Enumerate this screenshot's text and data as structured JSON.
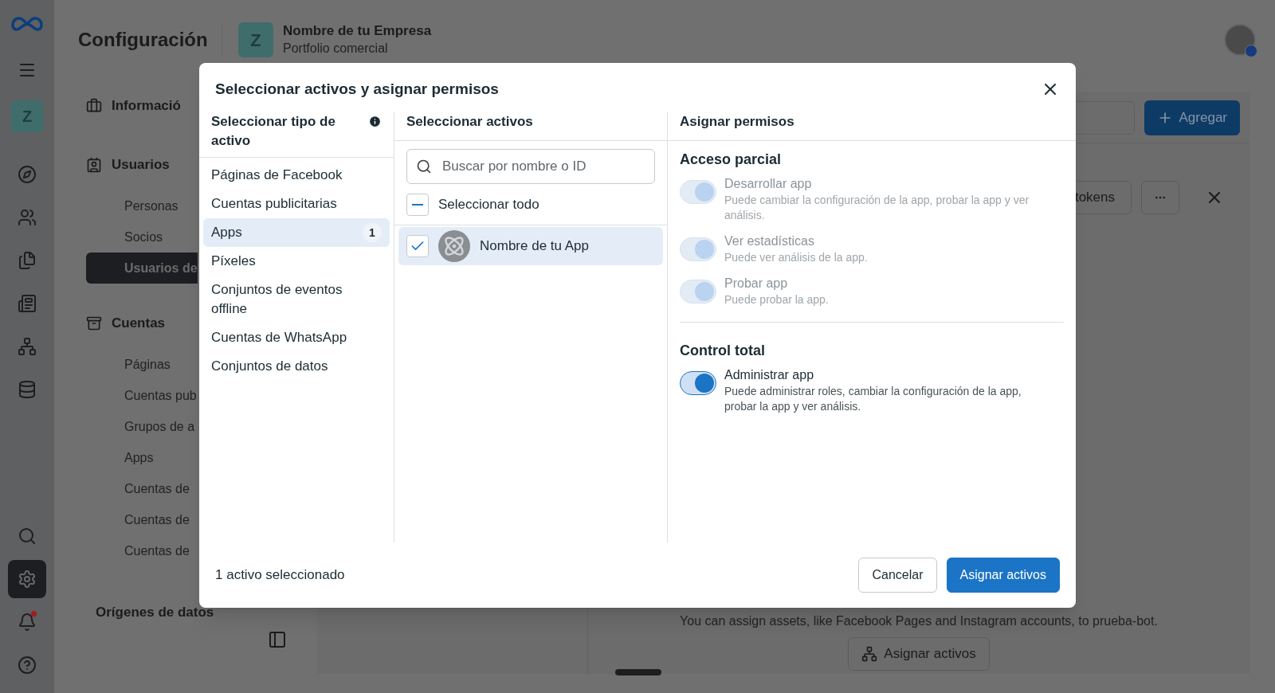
{
  "rail": {
    "avatar": "Z",
    "bottom_items": [
      {
        "selected": false,
        "notification": false
      },
      {
        "selected": true,
        "notification": false
      },
      {
        "selected": false,
        "notification": true
      },
      {
        "selected": false,
        "notification": false
      }
    ]
  },
  "header": {
    "title": "Configuración",
    "business": {
      "initial": "Z",
      "name": "Nombre de tu Empresa",
      "subtitle": "Portfolio comercial"
    }
  },
  "nav": {
    "sections": [
      {
        "title": "Informació"
      },
      {
        "title": "Usuarios",
        "items": [
          {
            "label": "Personas",
            "selected": false
          },
          {
            "label": "Socios",
            "selected": false
          },
          {
            "label": "Usuarios de",
            "selected": true
          }
        ]
      },
      {
        "title": "Cuentas",
        "items": [
          {
            "label": "Páginas",
            "selected": false
          },
          {
            "label": "Cuentas pub",
            "selected": false
          },
          {
            "label": "Grupos de a",
            "selected": false
          },
          {
            "label": "Apps",
            "selected": false
          },
          {
            "label": "Cuentas de",
            "selected": false
          },
          {
            "label": "Cuentas de",
            "selected": false
          },
          {
            "label": "Cuentas de",
            "selected": false
          }
        ]
      },
      {
        "title": "Orígenes de datos"
      }
    ]
  },
  "content": {
    "add_button": "Agregar",
    "tokens_button": "tokens",
    "info_text": "You can assign assets, like Facebook Pages and Instagram accounts, to prueba-bot.",
    "assign_button": "Asignar activos"
  },
  "dialog": {
    "title": "Seleccionar activos y asignar permisos",
    "asset_types": {
      "heading": "Seleccionar tipo de activo",
      "items": [
        {
          "label": "Páginas de Facebook",
          "selected": false
        },
        {
          "label": "Cuentas publicitarias",
          "selected": false
        },
        {
          "label": "Apps",
          "selected": true,
          "count": "1"
        },
        {
          "label": "Píxeles",
          "selected": false
        },
        {
          "label": "Conjuntos de eventos offline",
          "selected": false
        },
        {
          "label": "Cuentas de WhatsApp",
          "selected": false
        },
        {
          "label": "Conjuntos de datos",
          "selected": false
        }
      ]
    },
    "assets": {
      "heading": "Seleccionar activos",
      "search_placeholder": "Buscar por nombre o ID",
      "select_all": {
        "label": "Seleccionar todo",
        "indeterminate": true
      },
      "items": [
        {
          "name": "Nombre de tu App",
          "checked": true
        }
      ]
    },
    "permissions": {
      "heading": "Asignar permisos",
      "groups": [
        {
          "title": "Acceso parcial",
          "items": [
            {
              "name": "Desarrollar app",
              "description": "Puede cambiar la configuración de la app, probar la app y ver análisis.",
              "on": true,
              "disabled": true
            },
            {
              "name": "Ver estadísticas",
              "description": "Puede ver análisis de la app.",
              "on": true,
              "disabled": true
            },
            {
              "name": "Probar app",
              "description": "Puede probar la app.",
              "on": true,
              "disabled": true
            }
          ]
        },
        {
          "title": "Control total",
          "items": [
            {
              "name": "Administrar app",
              "description": "Puede administrar roles, cambiar la configuración de la app, probar la app y ver análisis.",
              "on": true,
              "disabled": false
            }
          ]
        }
      ]
    },
    "footer": {
      "summary": "1 activo seleccionado",
      "buttons": [
        {
          "label": "Cancelar",
          "kind": "secondary"
        },
        {
          "label": "Asignar activos",
          "kind": "primary"
        }
      ]
    }
  }
}
